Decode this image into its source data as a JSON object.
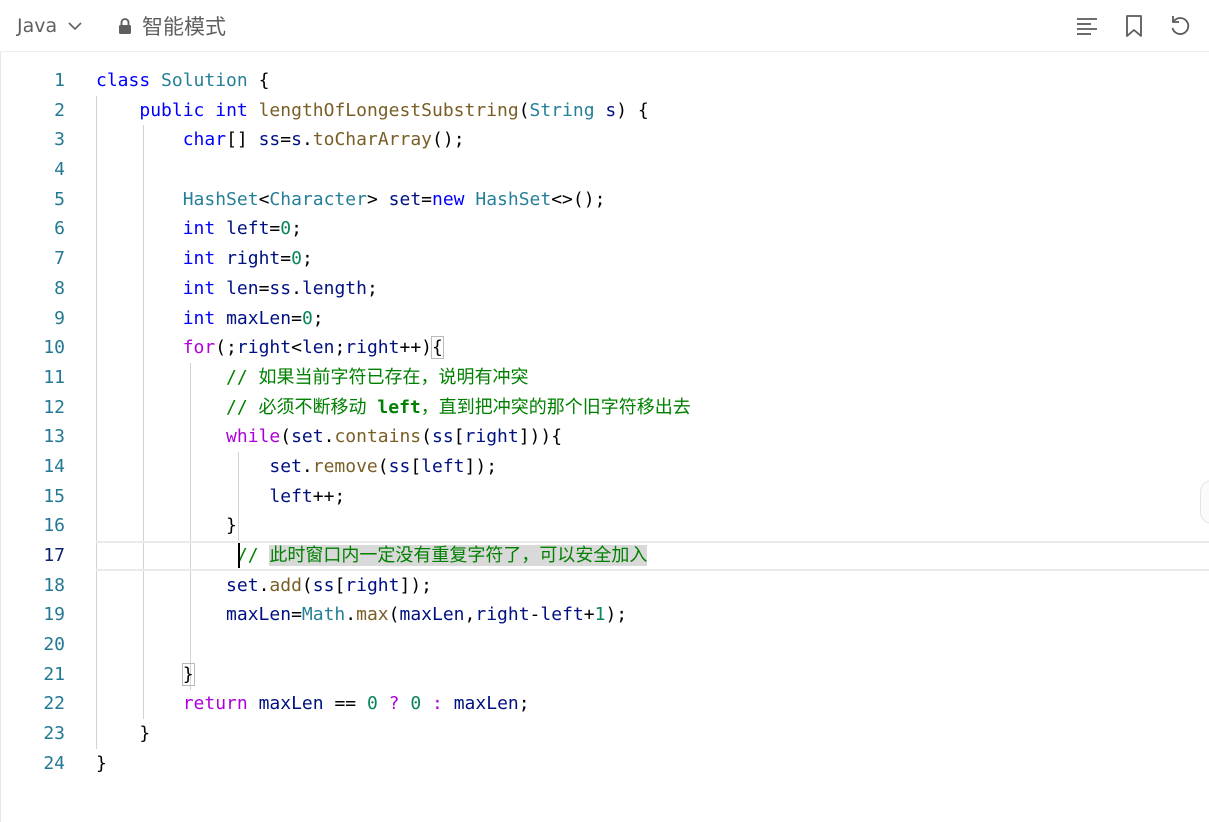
{
  "toolbar": {
    "language": "Java",
    "mode": "智能模式",
    "icons": [
      "chevron-down-icon",
      "lock-icon",
      "format-icon",
      "bookmark-icon",
      "reset-icon"
    ]
  },
  "editor": {
    "active_line": 17,
    "lines": [
      {
        "n": "1",
        "tokens": [
          [
            "keyword",
            "class"
          ],
          [
            "plain",
            " "
          ],
          [
            "type",
            "Solution"
          ],
          [
            "plain",
            " {"
          ]
        ]
      },
      {
        "n": "2",
        "tokens": [
          [
            "plain",
            "    "
          ],
          [
            "keyword",
            "public"
          ],
          [
            "plain",
            " "
          ],
          [
            "keyword",
            "int"
          ],
          [
            "plain",
            " "
          ],
          [
            "func",
            "lengthOfLongestSubstring"
          ],
          [
            "plain",
            "("
          ],
          [
            "type",
            "String"
          ],
          [
            "plain",
            " "
          ],
          [
            "member",
            "s"
          ],
          [
            "plain",
            ") {"
          ]
        ]
      },
      {
        "n": "3",
        "tokens": [
          [
            "plain",
            "        "
          ],
          [
            "keyword",
            "char"
          ],
          [
            "plain",
            "[] "
          ],
          [
            "member",
            "ss"
          ],
          [
            "plain",
            "="
          ],
          [
            "member",
            "s"
          ],
          [
            "plain",
            "."
          ],
          [
            "func",
            "toCharArray"
          ],
          [
            "plain",
            "();"
          ]
        ]
      },
      {
        "n": "4",
        "tokens": []
      },
      {
        "n": "5",
        "tokens": [
          [
            "plain",
            "        "
          ],
          [
            "type",
            "HashSet"
          ],
          [
            "plain",
            "<"
          ],
          [
            "type",
            "Character"
          ],
          [
            "plain",
            "> "
          ],
          [
            "member",
            "set"
          ],
          [
            "plain",
            "="
          ],
          [
            "keyword",
            "new"
          ],
          [
            "plain",
            " "
          ],
          [
            "type",
            "HashSet"
          ],
          [
            "plain",
            "<>();"
          ]
        ]
      },
      {
        "n": "6",
        "tokens": [
          [
            "plain",
            "        "
          ],
          [
            "keyword",
            "int"
          ],
          [
            "plain",
            " "
          ],
          [
            "member",
            "left"
          ],
          [
            "plain",
            "="
          ],
          [
            "number",
            "0"
          ],
          [
            "plain",
            ";"
          ]
        ]
      },
      {
        "n": "7",
        "tokens": [
          [
            "plain",
            "        "
          ],
          [
            "keyword",
            "int"
          ],
          [
            "plain",
            " "
          ],
          [
            "member",
            "right"
          ],
          [
            "plain",
            "="
          ],
          [
            "number",
            "0"
          ],
          [
            "plain",
            ";"
          ]
        ]
      },
      {
        "n": "8",
        "tokens": [
          [
            "plain",
            "        "
          ],
          [
            "keyword",
            "int"
          ],
          [
            "plain",
            " "
          ],
          [
            "member",
            "len"
          ],
          [
            "plain",
            "="
          ],
          [
            "member",
            "ss"
          ],
          [
            "plain",
            "."
          ],
          [
            "member",
            "length"
          ],
          [
            "plain",
            ";"
          ]
        ]
      },
      {
        "n": "9",
        "tokens": [
          [
            "plain",
            "        "
          ],
          [
            "keyword",
            "int"
          ],
          [
            "plain",
            " "
          ],
          [
            "member",
            "maxLen"
          ],
          [
            "plain",
            "="
          ],
          [
            "number",
            "0"
          ],
          [
            "plain",
            ";"
          ]
        ]
      },
      {
        "n": "10",
        "tokens": [
          [
            "plain",
            "        "
          ],
          [
            "control",
            "for"
          ],
          [
            "plain",
            "(;"
          ],
          [
            "member",
            "right"
          ],
          [
            "plain",
            "<"
          ],
          [
            "member",
            "len"
          ],
          [
            "plain",
            ";"
          ],
          [
            "member",
            "right"
          ],
          [
            "plain",
            "++)"
          ],
          [
            "brace",
            "{"
          ]
        ]
      },
      {
        "n": "11",
        "tokens": [
          [
            "plain",
            "            "
          ],
          [
            "comment",
            "// 如果当前字符已存在，说明有冲突"
          ]
        ]
      },
      {
        "n": "12",
        "tokens": [
          [
            "plain",
            "            "
          ],
          [
            "comment",
            "// 必须不断移动 "
          ],
          [
            "bold",
            "left"
          ],
          [
            "comment",
            "，直到把冲突的那个旧字符移出去"
          ]
        ]
      },
      {
        "n": "13",
        "tokens": [
          [
            "plain",
            "            "
          ],
          [
            "control",
            "while"
          ],
          [
            "plain",
            "("
          ],
          [
            "member",
            "set"
          ],
          [
            "plain",
            "."
          ],
          [
            "func",
            "contains"
          ],
          [
            "plain",
            "("
          ],
          [
            "member",
            "ss"
          ],
          [
            "plain",
            "["
          ],
          [
            "member",
            "right"
          ],
          [
            "plain",
            "])){"
          ]
        ]
      },
      {
        "n": "14",
        "tokens": [
          [
            "plain",
            "                "
          ],
          [
            "member",
            "set"
          ],
          [
            "plain",
            "."
          ],
          [
            "func",
            "remove"
          ],
          [
            "plain",
            "("
          ],
          [
            "member",
            "ss"
          ],
          [
            "plain",
            "["
          ],
          [
            "member",
            "left"
          ],
          [
            "plain",
            "]);"
          ]
        ]
      },
      {
        "n": "15",
        "tokens": [
          [
            "plain",
            "                "
          ],
          [
            "member",
            "left"
          ],
          [
            "plain",
            "++;"
          ]
        ]
      },
      {
        "n": "16",
        "tokens": [
          [
            "plain",
            "            }"
          ]
        ]
      },
      {
        "n": "17",
        "tokens": [
          [
            "plain",
            "            "
          ],
          [
            "comment",
            " // "
          ],
          [
            "selcomment",
            "此时窗口内一定没有重复字符了，可以安全加入"
          ]
        ]
      },
      {
        "n": "18",
        "tokens": [
          [
            "plain",
            "            "
          ],
          [
            "member",
            "set"
          ],
          [
            "plain",
            "."
          ],
          [
            "func",
            "add"
          ],
          [
            "plain",
            "("
          ],
          [
            "member",
            "ss"
          ],
          [
            "plain",
            "["
          ],
          [
            "member",
            "right"
          ],
          [
            "plain",
            "]);"
          ]
        ]
      },
      {
        "n": "19",
        "tokens": [
          [
            "plain",
            "            "
          ],
          [
            "member",
            "maxLen"
          ],
          [
            "plain",
            "="
          ],
          [
            "type",
            "Math"
          ],
          [
            "plain",
            "."
          ],
          [
            "func",
            "max"
          ],
          [
            "plain",
            "("
          ],
          [
            "member",
            "maxLen"
          ],
          [
            "plain",
            ","
          ],
          [
            "member",
            "right"
          ],
          [
            "plain",
            "-"
          ],
          [
            "member",
            "left"
          ],
          [
            "plain",
            "+"
          ],
          [
            "number",
            "1"
          ],
          [
            "plain",
            ");"
          ]
        ]
      },
      {
        "n": "20",
        "tokens": []
      },
      {
        "n": "21",
        "tokens": [
          [
            "plain",
            "        "
          ],
          [
            "brace",
            "}"
          ]
        ]
      },
      {
        "n": "22",
        "tokens": [
          [
            "plain",
            "        "
          ],
          [
            "control",
            "return"
          ],
          [
            "plain",
            " "
          ],
          [
            "member",
            "maxLen"
          ],
          [
            "plain",
            " == "
          ],
          [
            "number",
            "0"
          ],
          [
            "plain",
            " "
          ],
          [
            "control",
            "?"
          ],
          [
            "plain",
            " "
          ],
          [
            "number",
            "0"
          ],
          [
            "plain",
            " "
          ],
          [
            "control",
            ":"
          ],
          [
            "plain",
            " "
          ],
          [
            "member",
            "maxLen"
          ],
          [
            "plain",
            ";"
          ]
        ]
      },
      {
        "n": "23",
        "tokens": [
          [
            "plain",
            "    }"
          ]
        ]
      },
      {
        "n": "24",
        "tokens": [
          [
            "plain",
            "}"
          ]
        ]
      }
    ]
  },
  "colors": {
    "keyword": "#0000ff",
    "type": "#267f99",
    "function": "#795e26",
    "control": "#af00db",
    "comment": "#008000",
    "number": "#098658",
    "line_number": "#237893"
  }
}
